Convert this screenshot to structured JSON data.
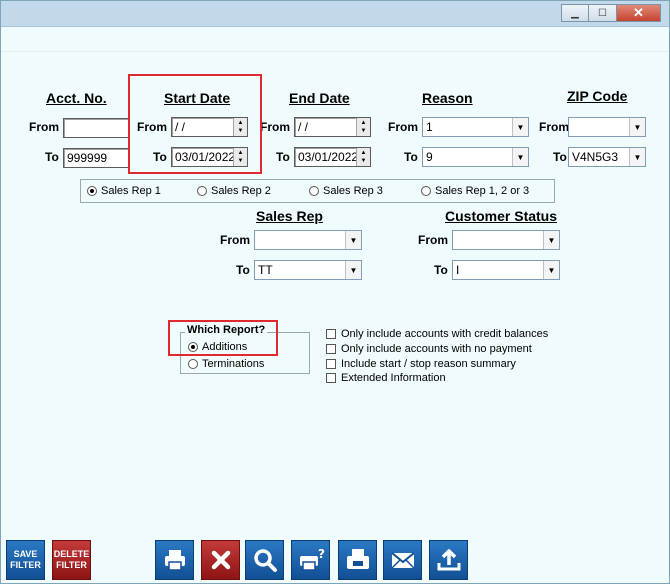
{
  "window": {
    "minimize": "▁",
    "maximize": "☐",
    "close": "✕"
  },
  "headers": {
    "acct_no": "Acct. No.",
    "start_date": "Start Date",
    "end_date": "End Date",
    "reason": "Reason",
    "zip_code": "ZIP Code",
    "sales_rep": "Sales Rep",
    "customer_status": "Customer Status"
  },
  "labels": {
    "from": "From",
    "to": "To"
  },
  "fields": {
    "acct_from": "",
    "acct_to": "999999",
    "start_from": " / /",
    "start_to": "03/01/2022",
    "end_from": " / /",
    "end_to": "03/01/2022",
    "reason_from": "1",
    "reason_to": "9",
    "zip_from": "",
    "zip_to": "V4N5G3",
    "salesrep_from": "",
    "salesrep_to": "TT",
    "status_from": "",
    "status_to": "I"
  },
  "sales_rep_options": [
    "Sales Rep 1",
    "Sales Rep 2",
    "Sales Rep 3",
    "Sales Rep 1, 2 or 3"
  ],
  "sales_rep_selected": 0,
  "which_report": {
    "title": "Which Report?",
    "options": [
      "Additions",
      "Terminations"
    ],
    "selected": 0
  },
  "checkboxes": [
    "Only include accounts with credit balances",
    "Only include accounts with no payment",
    "Include start / stop reason summary",
    "Extended Information"
  ],
  "toolbar": {
    "save_filter": "SAVE FILTER",
    "delete_filter": "DELETE FILTER",
    "icons": [
      "print-icon",
      "cancel-icon",
      "search-icon",
      "print-preview-icon",
      "fax-icon",
      "email-icon",
      "export-icon"
    ]
  },
  "colors": {
    "highlight": "#e0282e",
    "toolbar_blue": "#1a63ad",
    "toolbar_red": "#a82222"
  }
}
